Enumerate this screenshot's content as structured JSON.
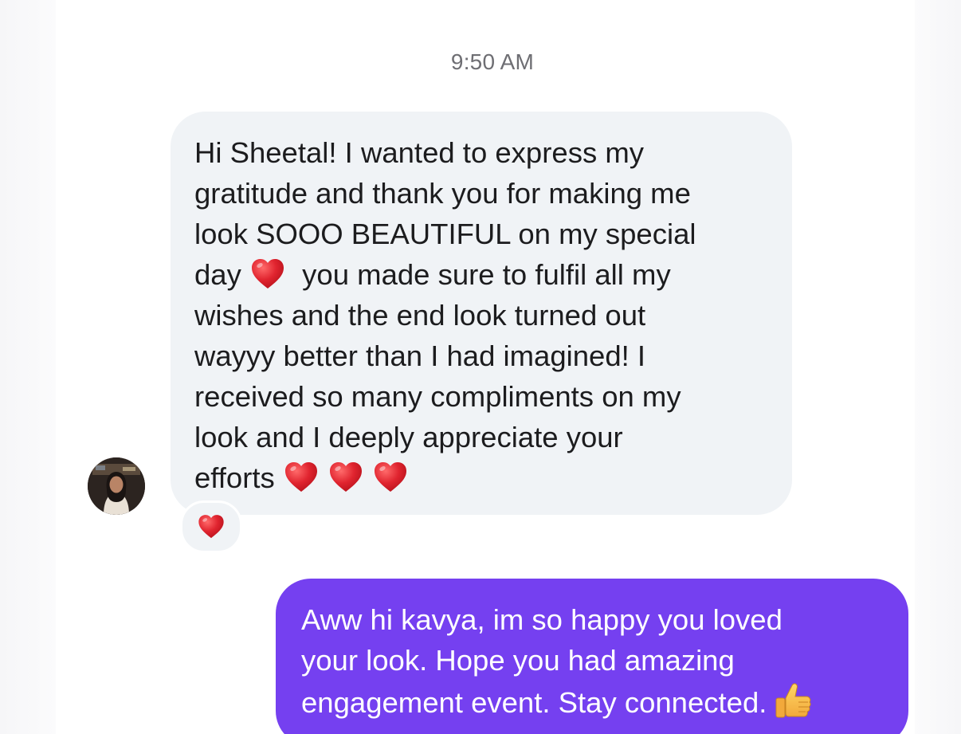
{
  "conversation": {
    "timestamp": "9:50 AM",
    "incoming_message": {
      "lines": [
        "Hi Sheetal! I wanted to express my",
        "gratitude and thank you for making me",
        "look SOOO BEAUTIFUL on my special",
        "day",
        "you made sure to fulfil all my",
        "wishes and the end look turned out",
        "wayyy better than I had imagined! I",
        "received so many compliments on my",
        "look and I deeply appreciate your",
        "efforts"
      ],
      "reaction": "red-heart-icon"
    },
    "outgoing_message": {
      "lines": [
        "Aww hi kavya, im so happy you loved",
        "your look. Hope you had amazing",
        "engagement event. Stay connected."
      ]
    }
  },
  "colors": {
    "incoming_bubble": "#f0f3f6",
    "outgoing_bubble": "#7540f0",
    "timestamp_text": "#6e6e73",
    "heart": "#e0242f"
  }
}
